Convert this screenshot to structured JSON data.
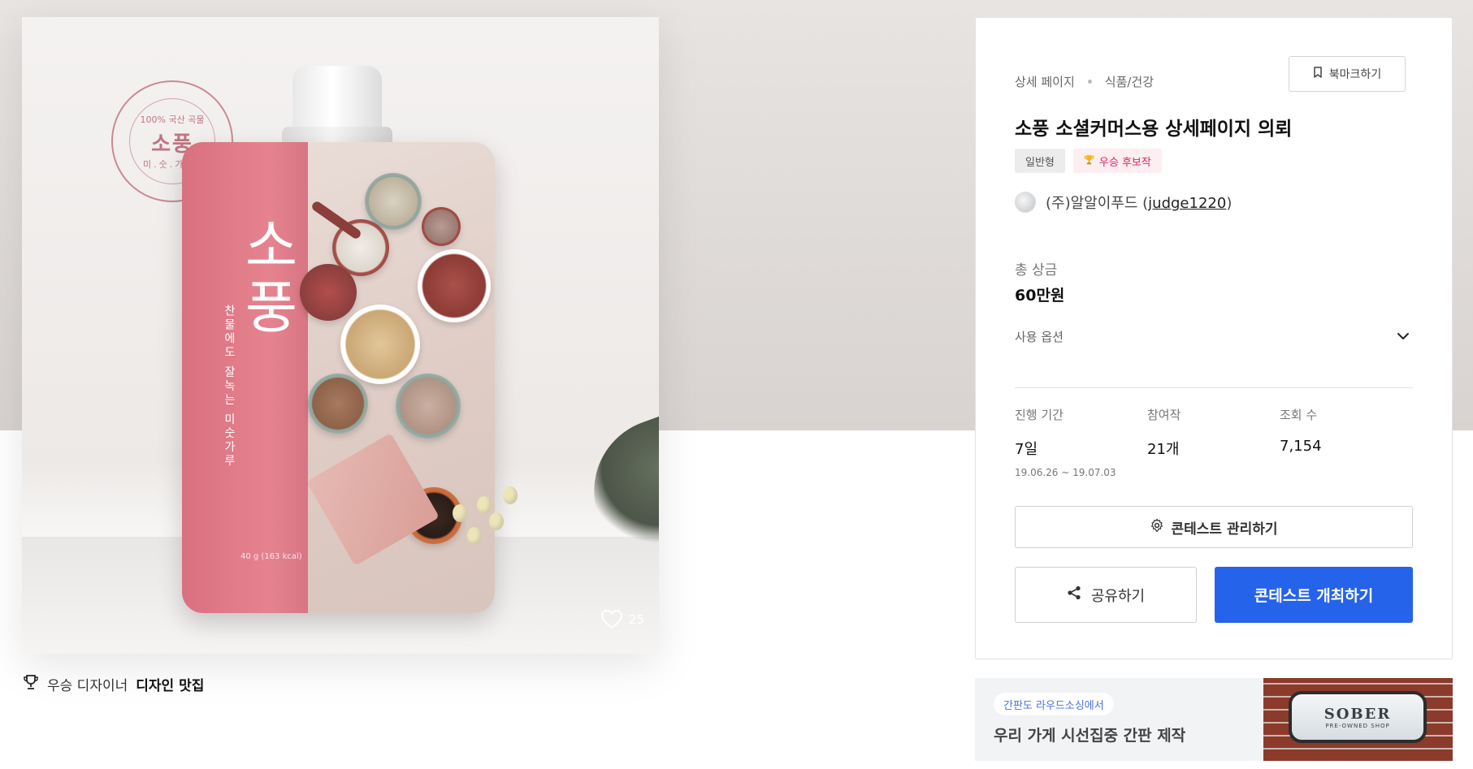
{
  "product": {
    "stamp_top": "100% 국산 곡물",
    "stamp_main": "소풍",
    "stamp_sub": "미.숫.가.루",
    "pouch_title": "소풍",
    "pouch_tagline": "찬물에도 잘녹는 미숫가루",
    "pouch_weight": "40 g (163 kcal)",
    "likes_count": "25"
  },
  "winner": {
    "prefix": "우승 디자이너",
    "designer": "디자인 맛집"
  },
  "info": {
    "breadcrumb": [
      "상세 페이지",
      "식품/건강"
    ],
    "bookmark_label": "북마크하기",
    "title": "소풍 소셜커머스용 상세페이지 의뢰",
    "tags": {
      "general": "일반형",
      "candidate": "우승 후보작"
    },
    "author": {
      "company": "(주)알알이푸드 (",
      "id": "judge1220",
      "close": ")"
    },
    "prize": {
      "label": "총 상금",
      "value": "60만원"
    },
    "options_label": "사용 옵션",
    "stats": {
      "period": {
        "label": "진행 기간",
        "value": "7일",
        "range": "19.06.26 ~ 19.07.03"
      },
      "entries": {
        "label": "참여작",
        "value": "21개"
      },
      "views": {
        "label": "조회 수",
        "value": "7,154"
      }
    },
    "manage_label": "콘테스트 관리하기",
    "share_label": "공유하기",
    "host_label": "콘테스트 개최하기"
  },
  "ad": {
    "tag": "간판도 라우드소싱에서",
    "title": "우리 가게 시선집중 간판 제작",
    "sign_main": "SOBER",
    "sign_sub": "PRE-OWNED SHOP"
  },
  "colors": {
    "primary": "#2563eb",
    "candidate_tag": "#e0246a",
    "pouch_pink": "#e6838f"
  }
}
